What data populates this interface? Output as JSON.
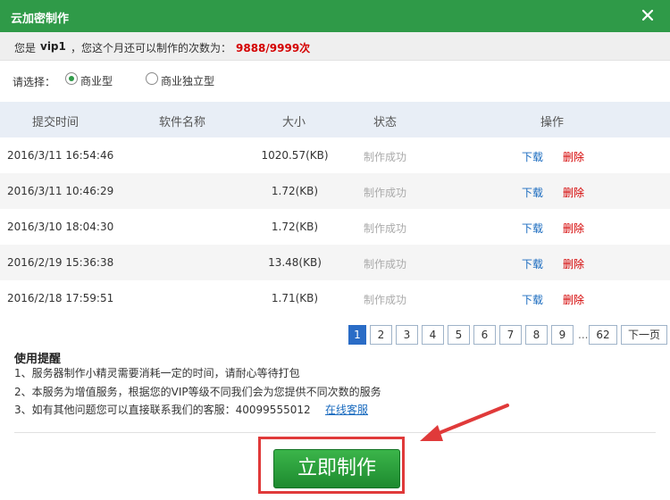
{
  "window": {
    "title": "云加密制作",
    "close_icon": "close-icon"
  },
  "info": {
    "prefix": "您是",
    "user": "vip1",
    "text": "，您这个月还可以制作的次数为：",
    "count": "9888/9999次",
    "count_color": "#d40000"
  },
  "select": {
    "label": "请选择：",
    "options": [
      {
        "label": "商业型",
        "selected": true
      },
      {
        "label": "商业独立型",
        "selected": false
      }
    ]
  },
  "table": {
    "headers": [
      "提交时间",
      "软件名称",
      "大小",
      "状态",
      "操作"
    ],
    "rows": [
      {
        "time": "2016/3/11 16:54:46",
        "name": "",
        "size": "1020.57(KB)",
        "status": "制作成功",
        "download": "下载",
        "delete": "删除"
      },
      {
        "time": "2016/3/11 10:46:29",
        "name": "",
        "size": "1.72(KB)",
        "status": "制作成功",
        "download": "下载",
        "delete": "删除"
      },
      {
        "time": "2016/3/10 18:04:30",
        "name": "",
        "size": "1.72(KB)",
        "status": "制作成功",
        "download": "下载",
        "delete": "删除"
      },
      {
        "time": "2016/2/19 15:36:38",
        "name": "",
        "size": "13.48(KB)",
        "status": "制作成功",
        "download": "下载",
        "delete": "删除"
      },
      {
        "time": "2016/2/18 17:59:51",
        "name": "",
        "size": "1.71(KB)",
        "status": "制作成功",
        "download": "下载",
        "delete": "删除"
      }
    ]
  },
  "pagination": {
    "current": "1",
    "pages": [
      "1",
      "2",
      "3",
      "4",
      "5",
      "6",
      "7",
      "8",
      "9"
    ],
    "ellipsis": "...",
    "last": "62",
    "next": "下一页"
  },
  "tips": {
    "title": "使用提醒",
    "lines": [
      "1、服务器制作小精灵需要消耗一定的时间，请耐心等待打包",
      "2、本服务为增值服务，根据您的VIP等级不同我们会为您提供不同次数的服务",
      "3、如有其他问题您可以直接联系我们的客服：40099555012"
    ],
    "link": "在线客服"
  },
  "action": {
    "make_label": "立即制作"
  },
  "colors": {
    "titlebar": "#2f9a48",
    "accent_blue": "#2a6cc6",
    "highlight_red": "#e03a3a"
  }
}
